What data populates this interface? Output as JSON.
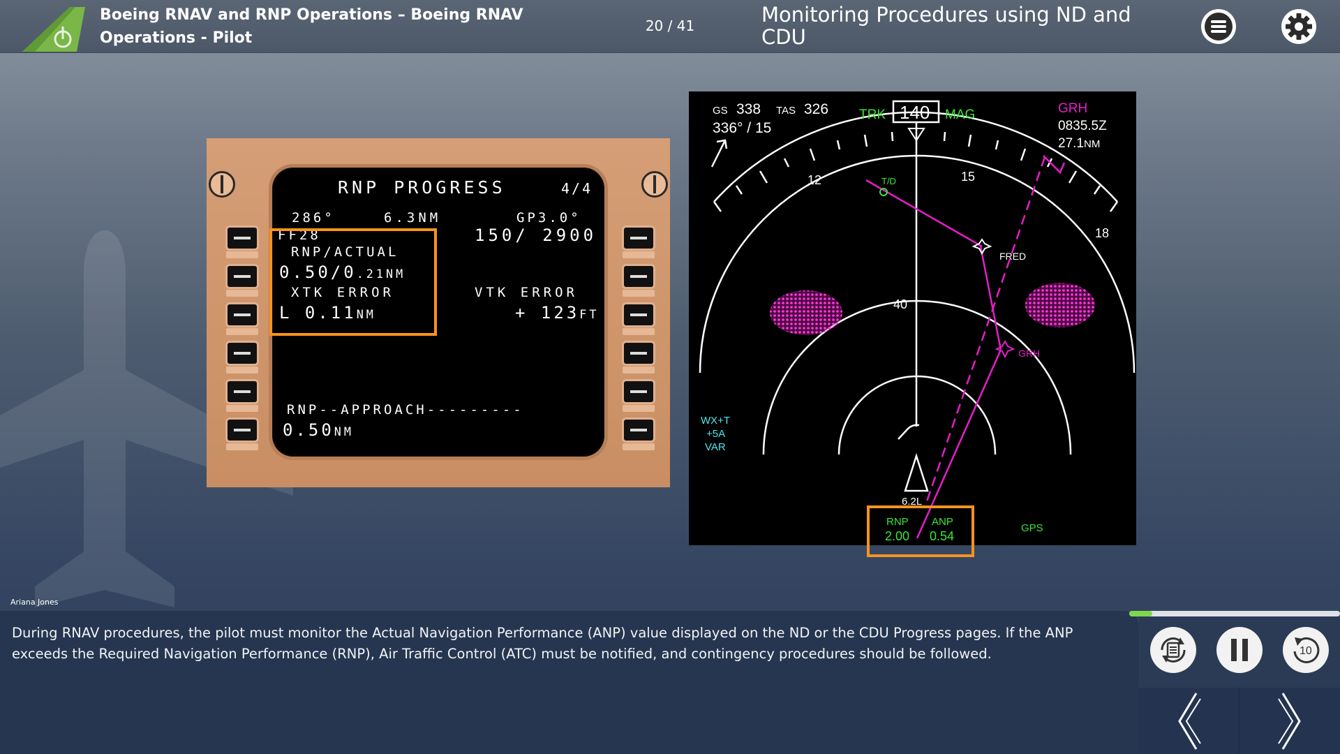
{
  "header": {
    "course_title": "Boeing RNAV and RNP Operations – Boeing RNAV Operations - Pilot",
    "page_counter": "20 / 41",
    "slide_title": "Monitoring Procedures using ND and CDU"
  },
  "icons": {
    "logo": "airplane-tail-power-icon",
    "menu": "menu-icon",
    "settings": "gear-icon",
    "transcript": "transcript-icon",
    "pause": "pause-icon",
    "rewind": "rewind-10-icon",
    "previous": "chevron-left-icon",
    "next": "chevron-right-icon"
  },
  "cdu": {
    "title": "RNP PROGRESS",
    "page": "4/4",
    "row1_left": "286°",
    "row1_mid": "6.3NM",
    "row1_right": "GP3.0°",
    "row2_left": "FF28",
    "row2_right": "150/ 2900",
    "rnp_actual_label": "RNP/ACTUAL",
    "rnp_actual_value": "0.50/0",
    "rnp_actual_small": ".21NM",
    "xtk_label": "XTK ERROR",
    "xtk_value": "L 0.11",
    "xtk_unit": "NM",
    "vtk_label": "VTK ERROR",
    "vtk_value": "+ 123",
    "vtk_unit": "FT",
    "approach_label": "RNP--APPROACH---------",
    "approach_value": "0.50",
    "approach_unit": "NM"
  },
  "nd": {
    "gs_label": "GS",
    "gs_value": "338",
    "tas_label": "TAS",
    "tas_value": "326",
    "wind": "336° / 15",
    "trk_label": "TRK",
    "heading": "140",
    "mag_label": "MAG",
    "wpt_name": "GRH",
    "wpt_eta": "0835.5Z",
    "wpt_dist": "27.1",
    "wpt_dist_unit": "NM",
    "scale_12": "12",
    "scale_15": "15",
    "scale_18": "18",
    "td_label": "T/D",
    "fix1": "FRED",
    "fix2": "GRH",
    "range": "40",
    "wx_line1": "WX+T",
    "wx_line2": "+5A",
    "wx_line3": "VAR",
    "range_small": "6.2L",
    "rnp_label": "RNP",
    "rnp_value": "2.00",
    "anp_label": "ANP",
    "anp_value": "0.54",
    "gps_label": "GPS",
    "colors": {
      "green": "#39e639",
      "magenta": "#e61ec8",
      "cyan": "#4ee6f0",
      "white": "#ffffff"
    }
  },
  "author": "Ariana Jones",
  "narration": "During RNAV procedures, the pilot must monitor the Actual Navigation Performance (ANP) value displayed on the ND or the CDU Progress pages. If the ANP exceeds the Required Navigation Performance (RNP), Air Traffic Control (ATC) must be notified, and contingency procedures should be followed.",
  "progress": {
    "value": 0.11
  },
  "colors": {
    "highlight": "#f7931e",
    "progress_fill": "#7fd84b"
  }
}
